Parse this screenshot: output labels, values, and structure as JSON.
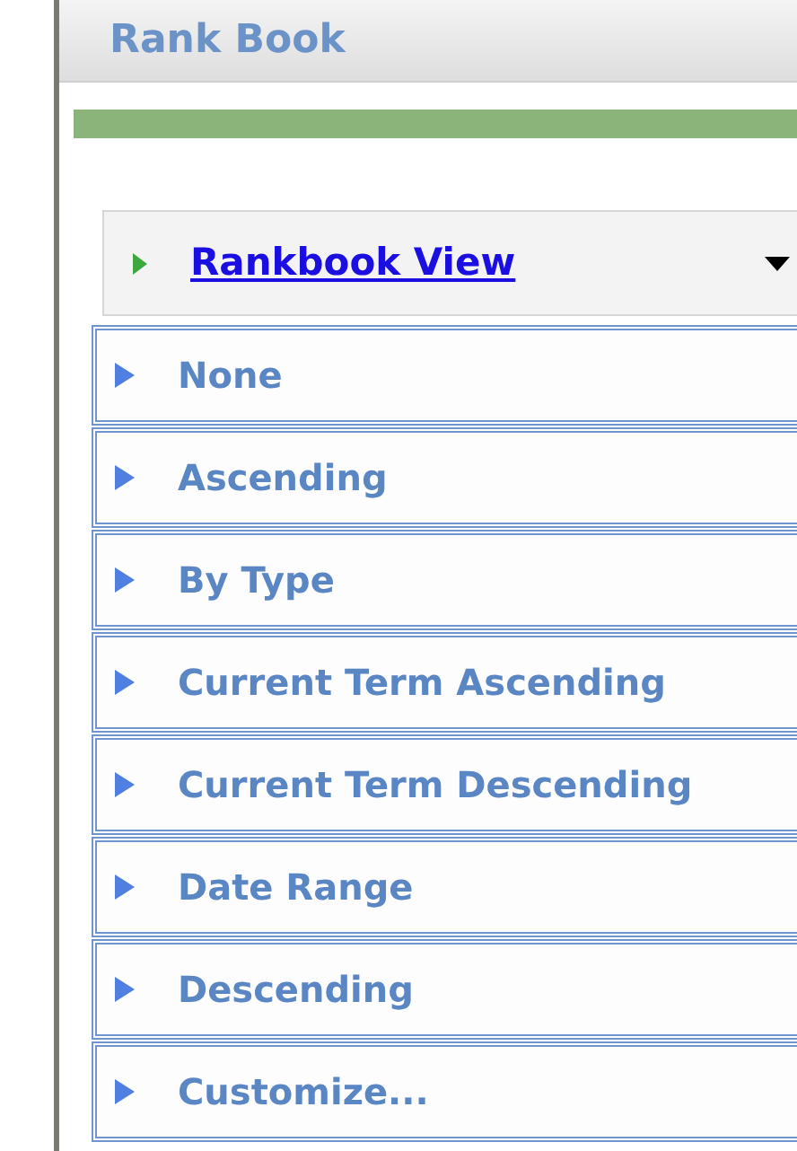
{
  "page_title": "Rank Book",
  "view_menu": {
    "label": "Rankbook View",
    "expanded": true,
    "items": [
      {
        "label": "None"
      },
      {
        "label": "Ascending"
      },
      {
        "label": "By Type"
      },
      {
        "label": "Current Term Ascending"
      },
      {
        "label": "Current Term Descending"
      },
      {
        "label": "Date Range"
      },
      {
        "label": "Descending"
      },
      {
        "label": "Customize..."
      }
    ]
  }
}
